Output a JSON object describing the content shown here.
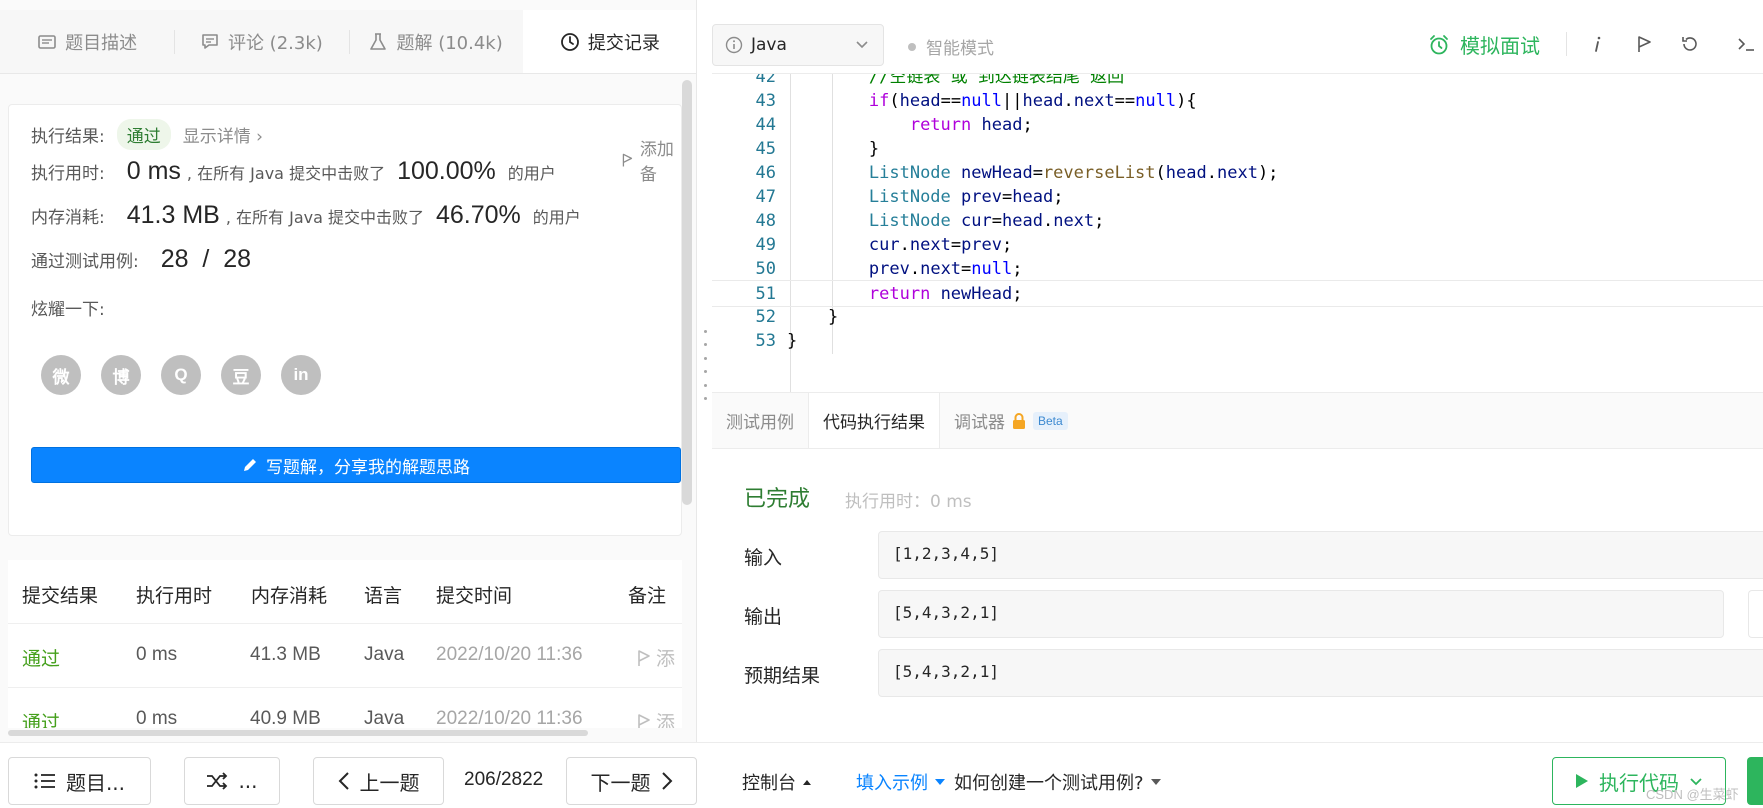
{
  "left_tabs": [
    {
      "label": "题目描述"
    },
    {
      "label": "评论 (2.3k)"
    },
    {
      "label": "题解 (10.4k)"
    },
    {
      "label": "提交记录"
    }
  ],
  "result": {
    "status_label": "执行结果:",
    "status_value": "通过",
    "detail_link": "显示详情 ›",
    "add_note": "添加备",
    "runtime_label": "执行用时:",
    "runtime_value": "0 ms",
    "runtime_middle": ", 在所有 Java 提交中击败了",
    "runtime_percent": "100.00%",
    "runtime_suffix": "的用户",
    "memory_label": "内存消耗:",
    "memory_value": "41.3 MB",
    "memory_middle": ", 在所有 Java 提交中击败了",
    "memory_percent": "46.70%",
    "memory_suffix": "的用户",
    "tests_label": "通过测试用例:",
    "tests_value": "28  /  28",
    "share_label": "炫耀一下:",
    "share_icons": [
      "wechat-icon",
      "weibo-icon",
      "qq-icon",
      "douban-icon",
      "linkedin-icon"
    ],
    "share_glyphs": [
      "微",
      "博",
      "Q",
      "豆",
      "in"
    ],
    "write_button": "写题解，分享我的解题思路"
  },
  "submissions": {
    "headers": [
      "提交结果",
      "执行用时",
      "内存消耗",
      "语言",
      "提交时间",
      "备注"
    ],
    "rows": [
      {
        "result": "通过",
        "time": "0 ms",
        "memory": "41.3 MB",
        "lang": "Java",
        "submitted": "2022/10/20 11:36",
        "note": "添"
      },
      {
        "result": "通过",
        "time": "0 ms",
        "memory": "40.9 MB",
        "lang": "Java",
        "submitted": "2022/10/20 11:36",
        "note": "添"
      }
    ]
  },
  "toolbar": {
    "language": "Java",
    "smart_mode": "智能模式",
    "mock_interview": "模拟面试"
  },
  "code_lines": [
    {
      "n": "42",
      "html": "        <span class=\"cm\">//空链表 或 到达链表结尾 返回</span>"
    },
    {
      "n": "43",
      "html": "        <span class=\"kw\">if</span>(<span class=\"id\">head</span>==<span class=\"kw2\">null</span>||<span class=\"id\">head</span>.<span class=\"id\">next</span>==<span class=\"kw2\">null</span>){"
    },
    {
      "n": "44",
      "html": "            <span class=\"kw\">return</span> <span class=\"id\">head</span>;"
    },
    {
      "n": "45",
      "html": "        }"
    },
    {
      "n": "46",
      "html": "        <span class=\"ty\">ListNode</span> <span class=\"id\">newHead</span>=<span class=\"fn\">reverseList</span>(<span class=\"id\">head</span>.<span class=\"id\">next</span>);"
    },
    {
      "n": "47",
      "html": "        <span class=\"ty\">ListNode</span> <span class=\"id\">prev</span>=<span class=\"id\">head</span>;"
    },
    {
      "n": "48",
      "html": "        <span class=\"ty\">ListNode</span> <span class=\"id\">cur</span>=<span class=\"id\">head</span>.<span class=\"id\">next</span>;"
    },
    {
      "n": "49",
      "html": "        <span class=\"id\">cur</span>.<span class=\"id\">next</span>=<span class=\"id\">prev</span>;"
    },
    {
      "n": "50",
      "html": "        <span class=\"id\">prev</span>.<span class=\"id\">next</span>=<span class=\"kw2\">null</span>;"
    },
    {
      "n": "51",
      "html": "        <span class=\"kw\">return</span> <span class=\"id\">newHead</span>;"
    },
    {
      "n": "52",
      "html": "    }"
    },
    {
      "n": "53",
      "html": "}"
    }
  ],
  "code_text": [
    "        //空链表 或 到达链表结尾 返回",
    "        if(head==null||head.next==null){",
    "            return head;",
    "        }",
    "        ListNode newHead=reverseList(head.next);",
    "        ListNode prev=head;",
    "        ListNode cur=head.next;",
    "        cur.next=prev;",
    "        prev.next=null;",
    "        return newHead;",
    "    }",
    "}"
  ],
  "console": {
    "tabs": [
      {
        "label": "测试用例"
      },
      {
        "label": "代码执行结果"
      },
      {
        "label": "调试器"
      }
    ],
    "beta": "Beta",
    "status": "已完成",
    "runtime": "执行用时：0 ms",
    "input_label": "输入",
    "input_value": "[1,2,3,4,5]",
    "output_label": "输出",
    "output_value": "[5,4,3,2,1]",
    "expected_label": "预期结果",
    "expected_value": "[5,4,3,2,1]"
  },
  "bottom": {
    "problem_list": "题目...",
    "random": "...",
    "prev": "上一题",
    "page": "206/2822",
    "next": "下一题",
    "console": "控制台",
    "fill_example": "填入示例",
    "how_create": "如何创建一个测试用例?",
    "run_code": "执行代码"
  },
  "watermark": "CSDN @生菜虾"
}
